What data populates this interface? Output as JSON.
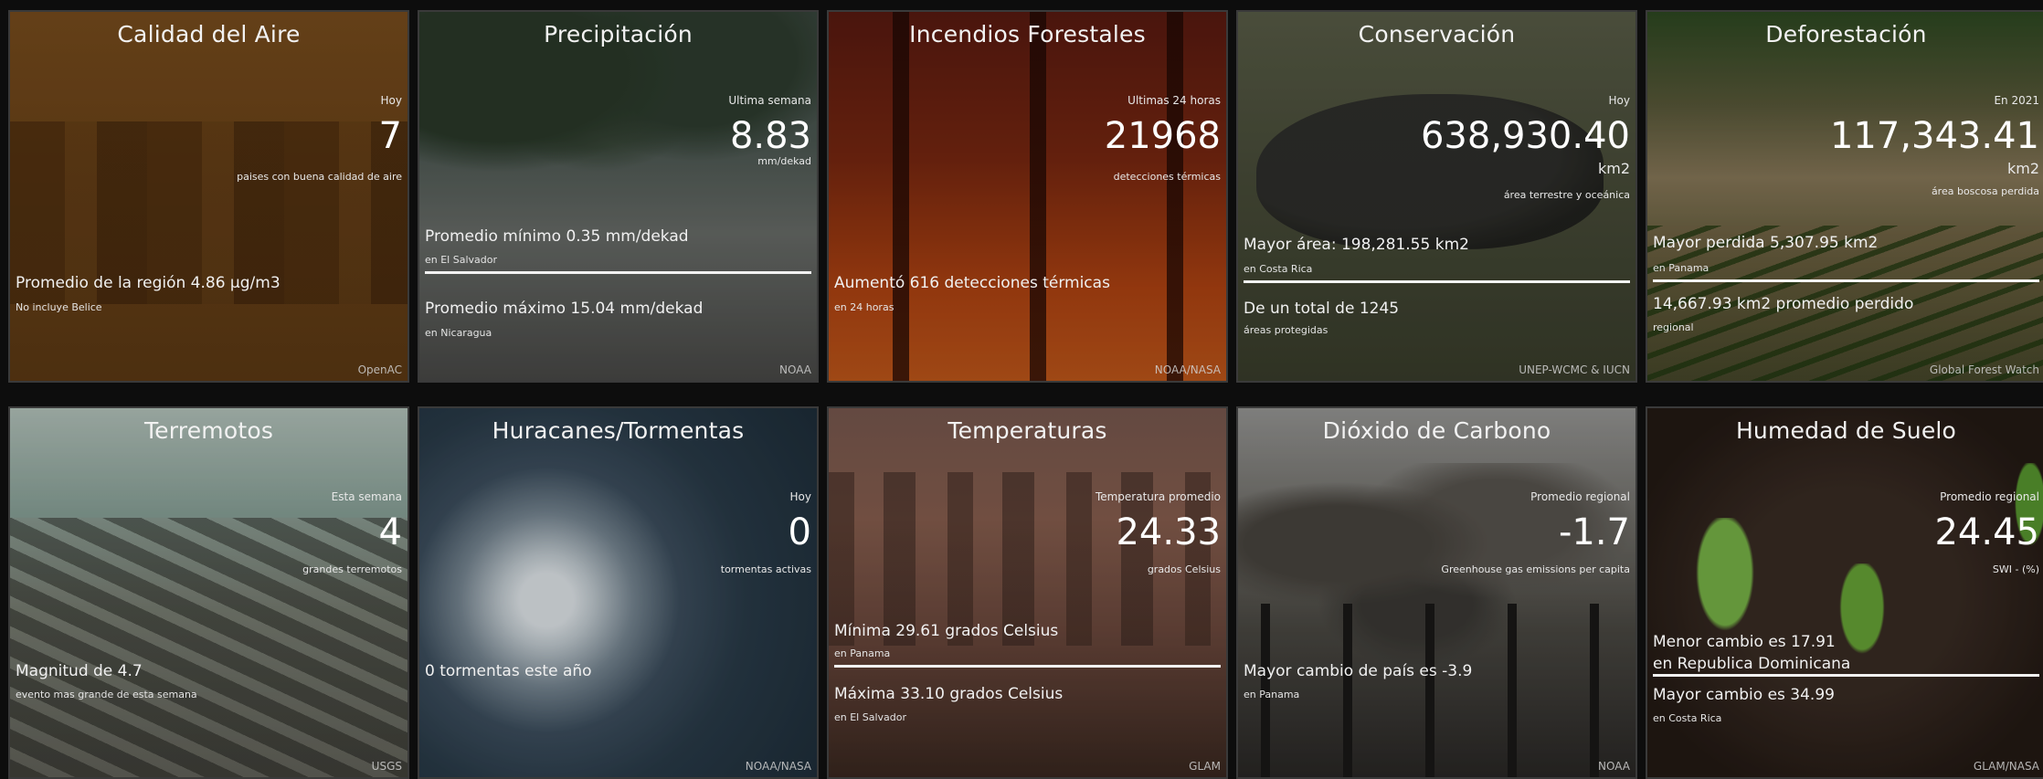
{
  "tiles": [
    {
      "title": "Calidad del Aire",
      "period": "Hoy",
      "value": "7",
      "unit": "",
      "desc": "paises con buena calidad de aire",
      "stat1": "",
      "stat1_sub": "",
      "stat2": "Promedio de la región 4.86 µg/m3",
      "stat2_sub": "No incluye Belice",
      "source": "OpenAC"
    },
    {
      "title": "Precipitación",
      "period": "Ultima semana",
      "value": "8.83",
      "unit": "mm/dekad",
      "desc": "",
      "stat1": "Promedio mínimo 0.35 mm/dekad",
      "stat1_sub": "en El Salvador",
      "stat2": "Promedio máximo 15.04 mm/dekad",
      "stat2_sub": "en Nicaragua",
      "source": "NOAA"
    },
    {
      "title": "Incendios Forestales",
      "period": "Ultimas 24 horas",
      "value": "21968",
      "unit": "detecciones térmicas",
      "desc": "",
      "stat1": "Aumentó 616 detecciones térmicas",
      "stat1_sub": "en 24 horas",
      "stat2": "",
      "stat2_sub": "",
      "source": "NOAA/NASA"
    },
    {
      "title": "Conservación",
      "period": "Hoy",
      "value": "638,930.40",
      "unit": "km2",
      "desc": "área terrestre y oceánica",
      "stat1": "Mayor área: 198,281.55 km2",
      "stat1_sub": "en Costa Rica",
      "stat2": "De un total de 1245",
      "stat2_sub": "áreas protegidas",
      "source": "UNEP-WCMC & IUCN"
    },
    {
      "title": "Deforestación",
      "period": "En 2021",
      "value": "117,343.41",
      "unit": "km2",
      "desc": "área boscosa perdida",
      "stat1": "Mayor perdida 5,307.95 km2",
      "stat1_sub": "en Panama",
      "stat2": "14,667.93 km2 promedio perdido",
      "stat2_sub": "regional",
      "source": "Global Forest Watch"
    },
    {
      "title": "Terremotos",
      "period": "Esta semana",
      "value": "4",
      "unit": "grandes terremotos",
      "desc": "",
      "stat1": "Magnitud de 4.7",
      "stat1_sub": "evento mas grande de esta semana",
      "stat2": "",
      "stat2_sub": "",
      "source": "USGS"
    },
    {
      "title": "Huracanes/Tormentas",
      "period": "Hoy",
      "value": "0",
      "unit": "tormentas activas",
      "desc": "",
      "stat1": "0 tormentas este año",
      "stat1_sub": "",
      "stat2": "",
      "stat2_sub": "",
      "source": "NOAA/NASA"
    },
    {
      "title": "Temperaturas",
      "period": "Temperatura promedio",
      "value": "24.33",
      "unit": "grados Celsius",
      "desc": "",
      "stat1": "Mínima 29.61 grados Celsius",
      "stat1_sub": "en Panama",
      "stat2": "Máxima 33.10 grados Celsius",
      "stat2_sub": "en El Salvador",
      "source": "GLAM"
    },
    {
      "title": "Dióxido de Carbono",
      "period": "Promedio regional",
      "value": "-1.7",
      "unit": "Greenhouse gas emissions per capita",
      "desc": "",
      "stat1": "Mayor cambio de país es -3.9",
      "stat1_sub": "en Panama",
      "stat2": "",
      "stat2_sub": "",
      "source": "NOAA"
    },
    {
      "title": "Humedad de Suelo",
      "period": "Promedio regional",
      "value": "24.45",
      "unit": "SWI - (%)",
      "desc": "",
      "stat1": "Menor cambio es 17.91",
      "stat1_sub": "en Republica Dominicana",
      "stat2": "Mayor cambio es 34.99",
      "stat2_sub": "en Costa Rica",
      "source": "GLAM/NASA"
    }
  ]
}
